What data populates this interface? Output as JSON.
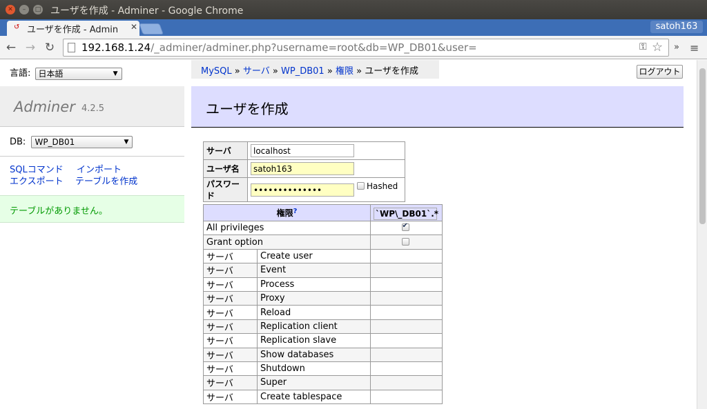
{
  "window": {
    "title": "ユーザを作成 - Adminer - Google Chrome",
    "tab_title": "ユーザを作成 - Admin",
    "profile": "satoh163"
  },
  "toolbar": {
    "url_host": "192.168.1.24",
    "url_path": "/_adminer/adminer.php?username=root&db=WP_DB01&user="
  },
  "sidebar": {
    "lang_label": "言語:",
    "lang_value": "日本語",
    "logo": "Adminer",
    "version": "4.2.5",
    "db_label": "DB:",
    "db_value": "WP_DB01",
    "links": {
      "sql": "SQLコマンド",
      "import": "インポート",
      "export": "エクスポート",
      "create_table": "テーブルを作成"
    },
    "notice": "テーブルがありません。"
  },
  "breadcrumb": {
    "mysql": "MySQL",
    "server": "サーバ",
    "db": "WP_DB01",
    "privileges": "権限",
    "current": "ユーザを作成",
    "sep": "»"
  },
  "logout_label": "ログアウト",
  "heading": "ユーザを作成",
  "form": {
    "server_label": "サーバ",
    "server_value": "localhost",
    "user_label": "ユーザ名",
    "user_value": "satoh163",
    "password_label": "パスワード",
    "password_value": "••••••••••••••",
    "hashed_label": "Hashed"
  },
  "privileges": {
    "header": "権限",
    "help": "?",
    "grant_target": "`WP\\_DB01`.*",
    "all_privileges": "All privileges",
    "grant_option": "Grant option",
    "rows": [
      {
        "context": "サーバ",
        "name": "Create user"
      },
      {
        "context": "サーバ",
        "name": "Event"
      },
      {
        "context": "サーバ",
        "name": "Process"
      },
      {
        "context": "サーバ",
        "name": "Proxy"
      },
      {
        "context": "サーバ",
        "name": "Reload"
      },
      {
        "context": "サーバ",
        "name": "Replication client"
      },
      {
        "context": "サーバ",
        "name": "Replication slave"
      },
      {
        "context": "サーバ",
        "name": "Show databases"
      },
      {
        "context": "サーバ",
        "name": "Shutdown"
      },
      {
        "context": "サーバ",
        "name": "Super"
      },
      {
        "context": "サーバ",
        "name": "Create tablespace"
      }
    ]
  }
}
